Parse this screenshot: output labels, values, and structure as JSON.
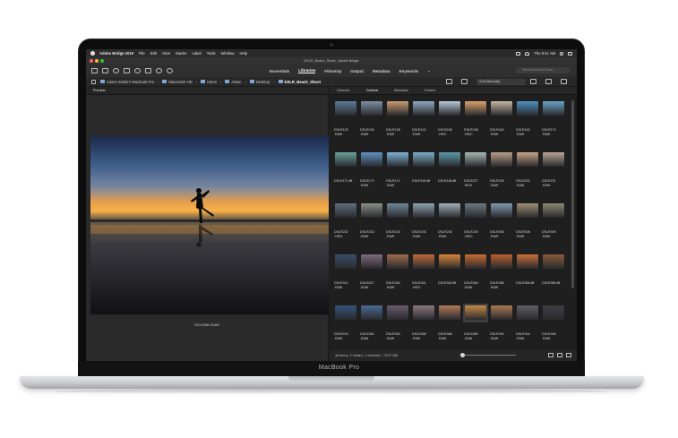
{
  "device": {
    "label": "MacBook Pro"
  },
  "menubar": {
    "app_name": "Adobe Bridge 2019",
    "items": [
      "File",
      "Edit",
      "View",
      "Stacks",
      "Label",
      "Tools",
      "Window",
      "Help"
    ],
    "clock": "Thu 9:41 AM"
  },
  "window": {
    "title": "DSLR_Beach_Shoot - Adobe Bridge"
  },
  "toolbar": {
    "workspaces": [
      "Essentials",
      "Libraries",
      "Filmstrip",
      "Output",
      "Metadata",
      "Keywords"
    ],
    "active_workspace": "Libraries",
    "search_placeholder": "Search Adobe Stock"
  },
  "pathbar": {
    "crumbs": [
      "Adam Hobbs's Macbook Pro",
      "Macintosh HD",
      "Users",
      "Adam",
      "Desktop",
      "DSLR_Beach_Shoot"
    ],
    "sort_label": "Sort Manually"
  },
  "preview": {
    "tab_label": "Preview",
    "caption": "DSLR382.RAW"
  },
  "content": {
    "tabs": [
      "Libraries",
      "Content",
      "Metadata",
      "Folders"
    ],
    "active_tab": "Content",
    "selected_index": 41,
    "items": [
      {
        "label": "DSLR120\n.RAW",
        "color": "#5c7c98"
      },
      {
        "label": "DSLR136\n.RAW",
        "color": "#7c8fa2"
      },
      {
        "label": "DSLR138\n.RAW",
        "color": "#c79a70"
      },
      {
        "label": "DSLR142\n.RAW",
        "color": "#8fa9c2"
      },
      {
        "label": "DSLR158\n.HEIC",
        "color": "#b7c8d6"
      },
      {
        "label": "DSLR158\n.HEIC",
        "color": "#d9a36a"
      },
      {
        "label": "DSLR160\n.RAW",
        "color": "#c5b6a0"
      },
      {
        "label": "DSLR162\n.RAW",
        "color": "#4f8fc0"
      },
      {
        "label": "DSLR170\n.RAW",
        "color": "#6aa3c8"
      },
      {
        "label": "DSLR171.tiff",
        "color": "#67a39b"
      },
      {
        "label": "DSLR173\n.RAW",
        "color": "#5e92c0"
      },
      {
        "label": "DSLR174\n.RAW",
        "color": "#7fb3d6"
      },
      {
        "label": "DSLR185.tiff",
        "color": "#7ab0c8"
      },
      {
        "label": "DSLR186.tiff",
        "color": "#5c99aa"
      },
      {
        "label": "DSLR227\n.MOV",
        "color": "#a6b9b0"
      },
      {
        "label": "DSLR228\n.RAW",
        "color": "#b99e86"
      },
      {
        "label": "DSLR230\n.RAW",
        "color": "#c8a488"
      },
      {
        "label": "DSLR231\n.RAW",
        "color": "#b8a692"
      },
      {
        "label": "DSLR232\n.HEIC",
        "color": "#5d6f7c"
      },
      {
        "label": "DSLR233\n.RAW",
        "color": "#8a8f86"
      },
      {
        "label": "DSLR234\n.RAW",
        "color": "#6f8899"
      },
      {
        "label": "DSLR235\n.RAW",
        "color": "#8da2ad"
      },
      {
        "label": "DSLR236\n.RAW",
        "color": "#a0afb7"
      },
      {
        "label": "DSLR239\n.HEIC",
        "color": "#6c7a80"
      },
      {
        "label": "DSLR306\n.RAW",
        "color": "#7f99ad"
      },
      {
        "label": "DSLR308\n.RAW",
        "color": "#9d8e74"
      },
      {
        "label": "DSLR309\n.RAW",
        "color": "#8c8a70"
      },
      {
        "label": "DSLR312\n.RAW",
        "color": "#3b4d6a"
      },
      {
        "label": "DSLR317\n.RAW",
        "color": "#806a7c"
      },
      {
        "label": "DSLR340\n.RAW",
        "color": "#a06a4a"
      },
      {
        "label": "DSLR341\n.HEIC",
        "color": "#c06a3a"
      },
      {
        "label": "DSLR345.tiff",
        "color": "#d8843a"
      },
      {
        "label": "DSLR364\n.RAW",
        "color": "#c76a32"
      },
      {
        "label": "DSLR366\n.RAW",
        "color": "#b8602e"
      },
      {
        "label": "DSLR366.tiff",
        "color": "#c8703a"
      },
      {
        "label": "DSLR366.tiff",
        "color": "#8a5a3a"
      },
      {
        "label": "DSLR376\n.RAW",
        "color": "#34527a"
      },
      {
        "label": "DSLR382\n.RAW",
        "color": "#4a6a94"
      },
      {
        "label": "DSLR383\n.RAW",
        "color": "#6a5a6e"
      },
      {
        "label": "DSLR385\n.RAW",
        "color": "#8a7a80"
      },
      {
        "label": "DSLR386\n.RAW",
        "color": "#b07b56"
      },
      {
        "label": "DSLR389\n.RAW",
        "color": "#c48a46"
      },
      {
        "label": "DSLR392\n.RAW",
        "color": "#a87a50"
      },
      {
        "label": "DSLR394\n.RAW",
        "color": "#5e5e66"
      },
      {
        "label": "DSLR396\n.RAW",
        "color": "#3e3e46"
      }
    ]
  },
  "status": {
    "text": "46 items, 2 hidden, 1 selected - 79.67 MB"
  },
  "colors": {
    "close": "#fd5f57",
    "minimize": "#febb2e",
    "maximize": "#29c941",
    "folder": "#7fa8d6"
  }
}
